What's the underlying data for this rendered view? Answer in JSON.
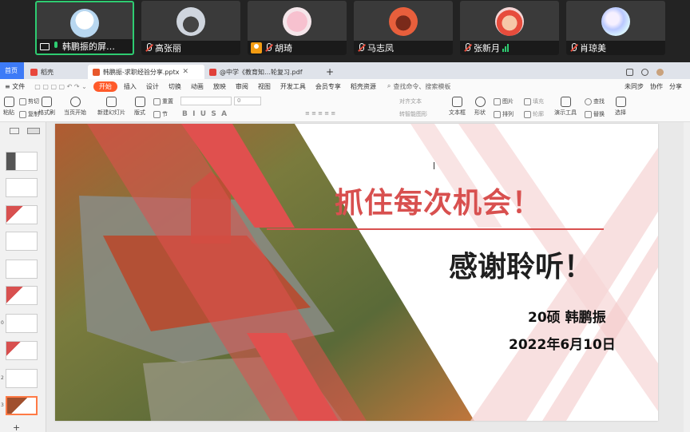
{
  "participants": [
    {
      "name": "韩鹏振的屏…",
      "state": "sharing"
    },
    {
      "name": "高张丽",
      "state": "muted"
    },
    {
      "name": "胡琦",
      "state": "muted"
    },
    {
      "name": "马志凤",
      "state": "muted"
    },
    {
      "name": "张新月",
      "state": "muted"
    },
    {
      "name": "肖琼美",
      "state": "muted"
    }
  ],
  "tabs": {
    "home": "首页",
    "t1": "稻壳",
    "t2": "韩鹏振-求职经验分享.pptx",
    "t3": "@中学《教育知…轮复习.pdf",
    "add": "+"
  },
  "menu": {
    "file": "文件",
    "items": [
      "开始",
      "插入",
      "设计",
      "切换",
      "动画",
      "放映",
      "审阅",
      "视图",
      "开发工具",
      "会员专享",
      "稻壳资源"
    ],
    "search": "查找命令、搜索模板",
    "right": [
      "未同步",
      "协作",
      "分享"
    ]
  },
  "ribbon": {
    "paste": "粘贴",
    "cut": "剪切",
    "copy": "复制",
    "format_painter": "格式刷",
    "from_current": "当页开始",
    "new_slide": "新建幻灯片",
    "layout": "版式",
    "section": "节",
    "reset": "重置",
    "font_size": "0",
    "text_box": "文本框",
    "shape": "形状",
    "picture": "图片",
    "arrange": "排列",
    "fill": "填充",
    "outline": "轮廓",
    "presenter_tools": "演示工具",
    "find": "查找",
    "replace": "替换",
    "select": "选择",
    "align_text": "对齐文本",
    "smart_art": "转智能图形"
  },
  "slide": {
    "headline": "抓住每次机会！",
    "thanks": "感谢聆听！",
    "presenter": "20硕  韩鹏振",
    "date": "2022年6月10日"
  },
  "thumb_numbers": [
    "",
    "",
    "",
    "",
    "",
    "",
    "0",
    "",
    "2",
    "3"
  ],
  "colors": {
    "accent_red": "#d8504f",
    "wps_orange": "#ff5a2a",
    "home_blue": "#3d7bf7",
    "active_green": "#2ecc71"
  }
}
